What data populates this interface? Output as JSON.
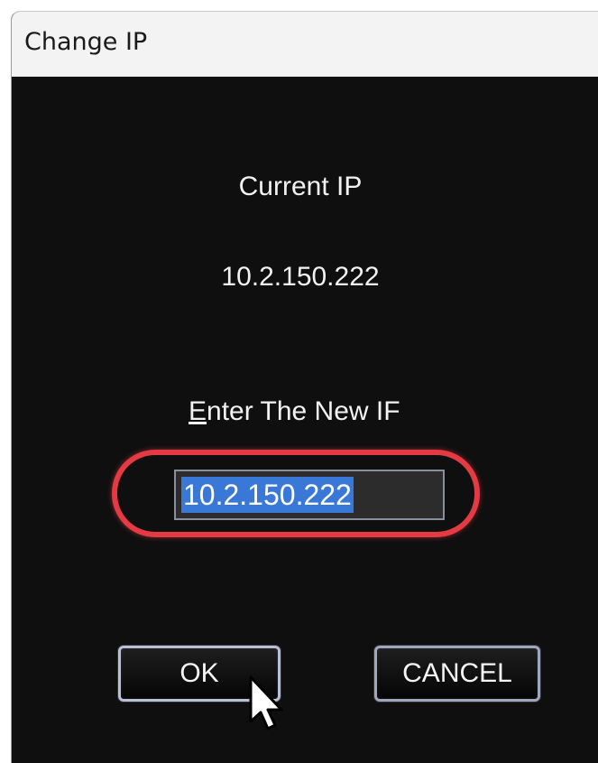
{
  "window": {
    "title": "Change IP"
  },
  "dialog": {
    "current_label": "Current IP",
    "current_ip": "10.2.150.222",
    "new_label_mnemonic": "E",
    "new_label_rest": "nter The New IF",
    "new_ip_value": "10.2.150.222",
    "ok_label": "OK",
    "cancel_label": "CANCEL"
  },
  "colors": {
    "background": "#0f0f0f",
    "text": "#f2f2f2",
    "selection": "#3a78d8",
    "highlight_ring": "#e43a43",
    "button_border": "#9fa6bf"
  },
  "icons": {
    "pointer": "mouse-pointer-icon"
  }
}
